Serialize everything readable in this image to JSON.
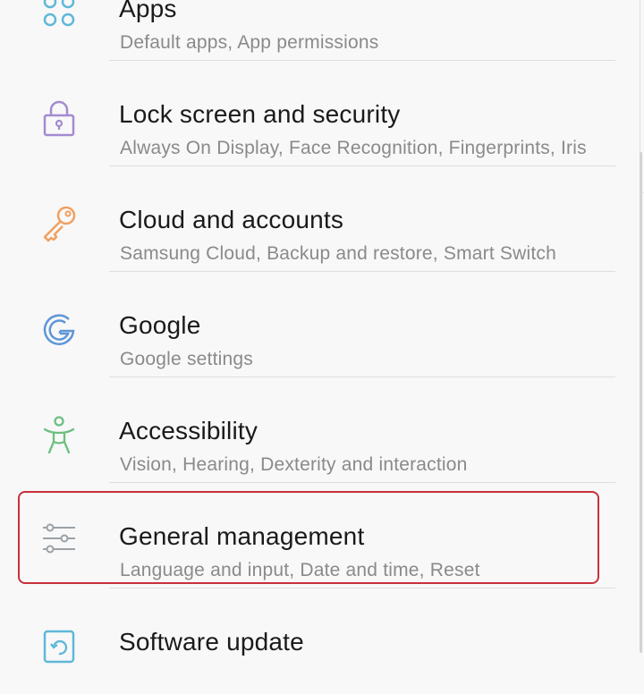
{
  "settings": {
    "items": [
      {
        "title": "Apps",
        "subtitle": "Default apps, App permissions",
        "icon": "apps-icon",
        "icon_color": "#5fb8d8"
      },
      {
        "title": "Lock screen and security",
        "subtitle": "Always On Display, Face Recognition, Fingerprints, Iris",
        "icon": "lock-icon",
        "icon_color": "#a48bd0"
      },
      {
        "title": "Cloud and accounts",
        "subtitle": "Samsung Cloud, Backup and restore, Smart Switch",
        "icon": "key-icon",
        "icon_color": "#f0a060"
      },
      {
        "title": "Google",
        "subtitle": "Google settings",
        "icon": "google-icon",
        "icon_color": "#5f96d8"
      },
      {
        "title": "Accessibility",
        "subtitle": "Vision, Hearing, Dexterity and interaction",
        "icon": "accessibility-icon",
        "icon_color": "#6cc080"
      },
      {
        "title": "General management",
        "subtitle": "Language and input, Date and time, Reset",
        "icon": "sliders-icon",
        "icon_color": "#9aa2a8"
      },
      {
        "title": "Software update",
        "subtitle": "",
        "icon": "software-update-icon",
        "icon_color": "#5fb8d8"
      }
    ],
    "highlighted_item": "General management",
    "highlight_color": "#c8303a"
  }
}
